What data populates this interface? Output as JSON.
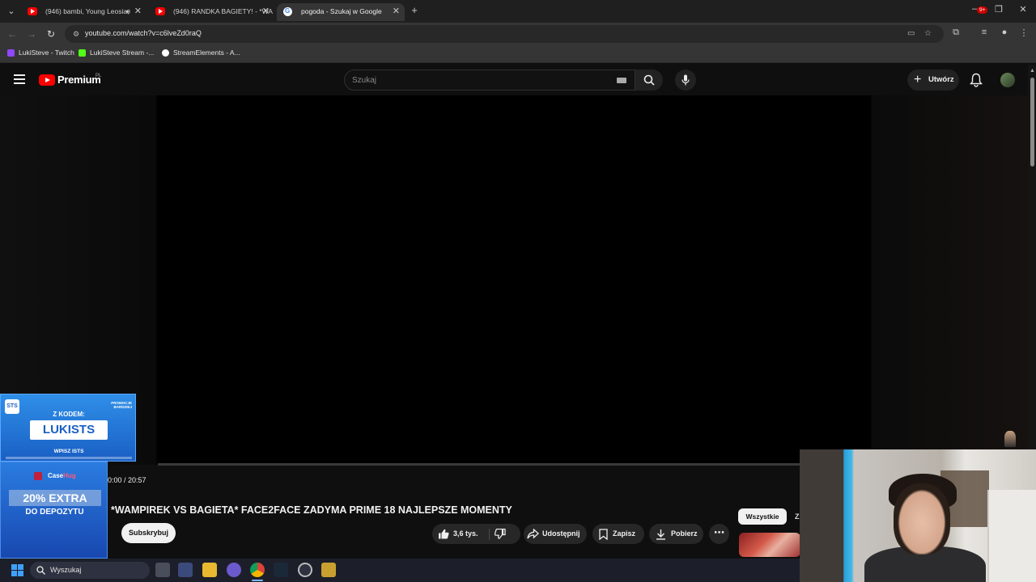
{
  "browser": {
    "tabs": [
      {
        "title": "(946) bambi, Young Leosia,",
        "type": "youtube",
        "audio": true
      },
      {
        "title": "(946) RANDKA BAGIETY! - *WA",
        "type": "youtube",
        "audio": false
      },
      {
        "title": "pogoda - Szukaj w Google",
        "type": "google",
        "audio": false
      }
    ],
    "active_tab": 2,
    "url": "youtube.com/watch?v=c6lveZd0raQ",
    "bookmarks": [
      {
        "label": "LukiSteve - Twitch",
        "color": "#9146ff"
      },
      {
        "label": "LukiSteve Stream -...",
        "color": "#53fc18"
      },
      {
        "label": "StreamElements - A...",
        "color": "#ffffff"
      }
    ]
  },
  "youtube": {
    "logo_text": "Premium",
    "logo_country": "PL",
    "search_placeholder": "Szukaj",
    "create_label": "Utwórz",
    "notifications_badge": "9+"
  },
  "player": {
    "time": "0:00 / 20:57",
    "progress_fraction": 0
  },
  "video": {
    "title": "*WAMPIREK VS BAGIETA* FACE2FACE ZADYMA PRIME 18 NAJLEPSZE MOMENTY",
    "subscribe_label": "Subskrybuj",
    "likes": "3,6 tys.",
    "share_label": "Udostępnij",
    "save_label": "Zapisz",
    "download_label": "Pobierz"
  },
  "recommendations": {
    "chip_all": "Wszystkie",
    "chip_next": "Z"
  },
  "overlays": {
    "promo_top": {
      "logo": "STS",
      "tag": "PROMOCJE BARDZIEJ",
      "line1": "Z KODEM:",
      "code": "LUKISTS",
      "line2": "WPISZ ISTS"
    },
    "promo_bottom": {
      "brand_a": "Case",
      "brand_b": "Hug",
      "extra": "20% EXTRA",
      "depo": "DO DEPOZYTU"
    }
  },
  "taskbar": {
    "search_placeholder": "Wyszukaj"
  },
  "colors": {
    "youtube_red": "#ff0000",
    "page_bg": "#0f0f0f",
    "promo_blue": "#1a5fc4"
  }
}
